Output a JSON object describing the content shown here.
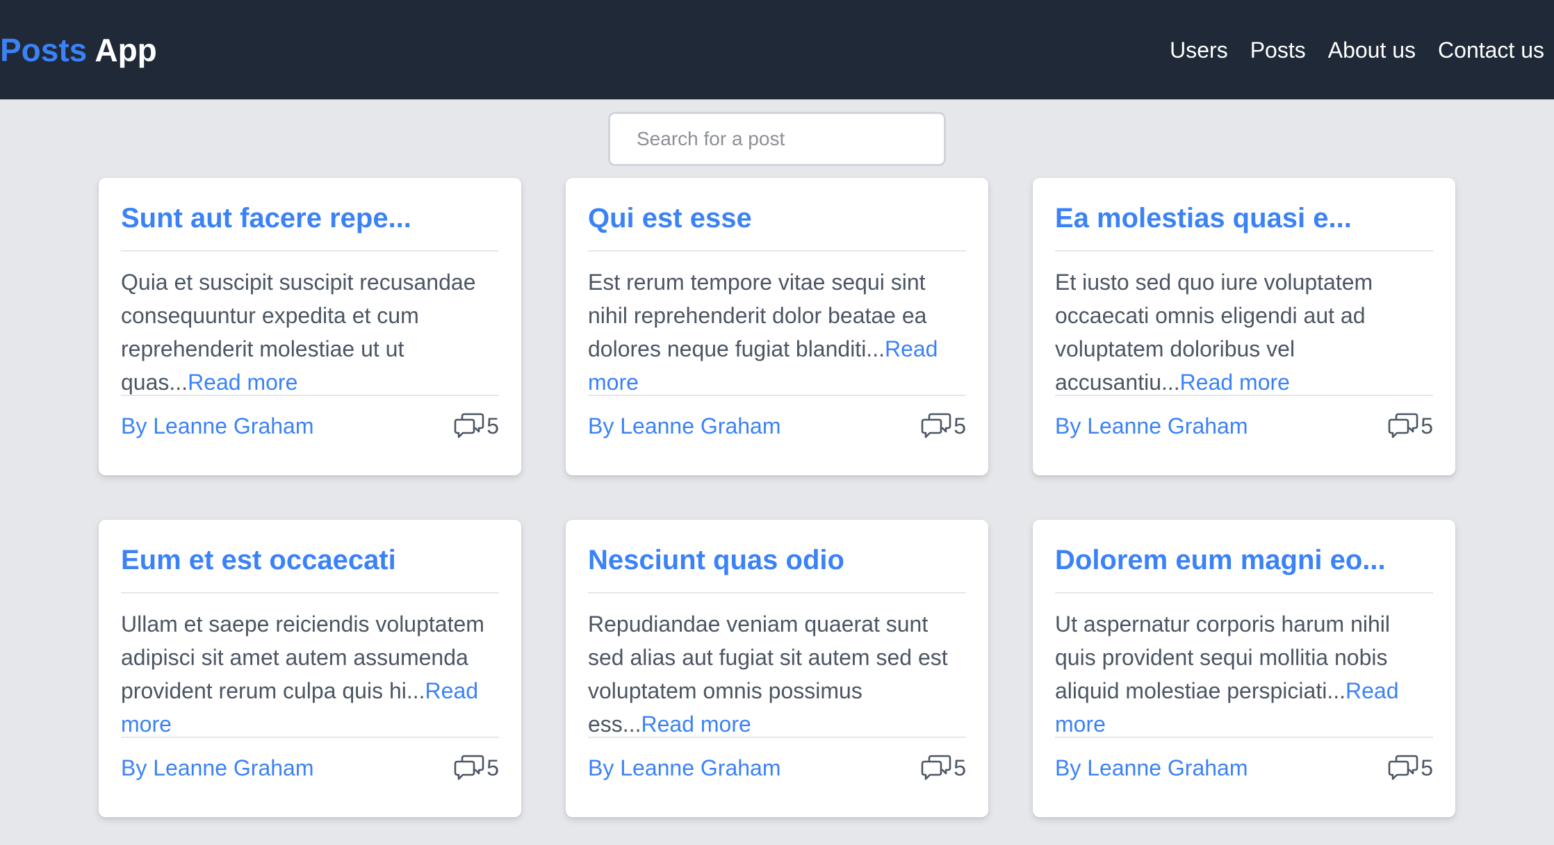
{
  "header": {
    "brand_accent": "Posts",
    "brand_rest": "App",
    "nav": [
      {
        "label": "Users"
      },
      {
        "label": "Posts"
      },
      {
        "label": "About us"
      },
      {
        "label": "Contact us"
      }
    ]
  },
  "search": {
    "placeholder": "Search for a post",
    "value": ""
  },
  "read_more_label": "Read more",
  "posts": [
    {
      "title": "Sunt aut facere repe...",
      "excerpt": "Quia et suscipit suscipit recusandae consequuntur expedita et cum reprehenderit molestiae ut ut quas...",
      "author": "By Leanne Graham",
      "comments": "5"
    },
    {
      "title": "Qui est esse",
      "excerpt": "Est rerum tempore vitae sequi sint nihil reprehenderit dolor beatae ea dolores neque fugiat blanditi...",
      "author": "By Leanne Graham",
      "comments": "5"
    },
    {
      "title": "Ea molestias quasi e...",
      "excerpt": "Et iusto sed quo iure voluptatem occaecati omnis eligendi aut ad voluptatem doloribus vel accusantiu...",
      "author": "By Leanne Graham",
      "comments": "5"
    },
    {
      "title": "Eum et est occaecati",
      "excerpt": "Ullam et saepe reiciendis voluptatem adipisci sit amet autem assumenda provident rerum culpa quis hi...",
      "author": "By Leanne Graham",
      "comments": "5"
    },
    {
      "title": "Nesciunt quas odio",
      "excerpt": "Repudiandae veniam quaerat sunt sed alias aut fugiat sit autem sed est voluptatem omnis possimus ess...",
      "author": "By Leanne Graham",
      "comments": "5"
    },
    {
      "title": "Dolorem eum magni eo...",
      "excerpt": "Ut aspernatur corporis harum nihil quis provident sequi mollitia nobis aliquid molestiae perspiciati...",
      "author": "By Leanne Graham",
      "comments": "5"
    }
  ],
  "icons": {
    "comments": "comments-icon"
  },
  "colors": {
    "navbar_bg": "#1f2937",
    "accent": "#3b82f6",
    "page_bg": "#e5e7eb",
    "body_text": "#4b5563"
  }
}
